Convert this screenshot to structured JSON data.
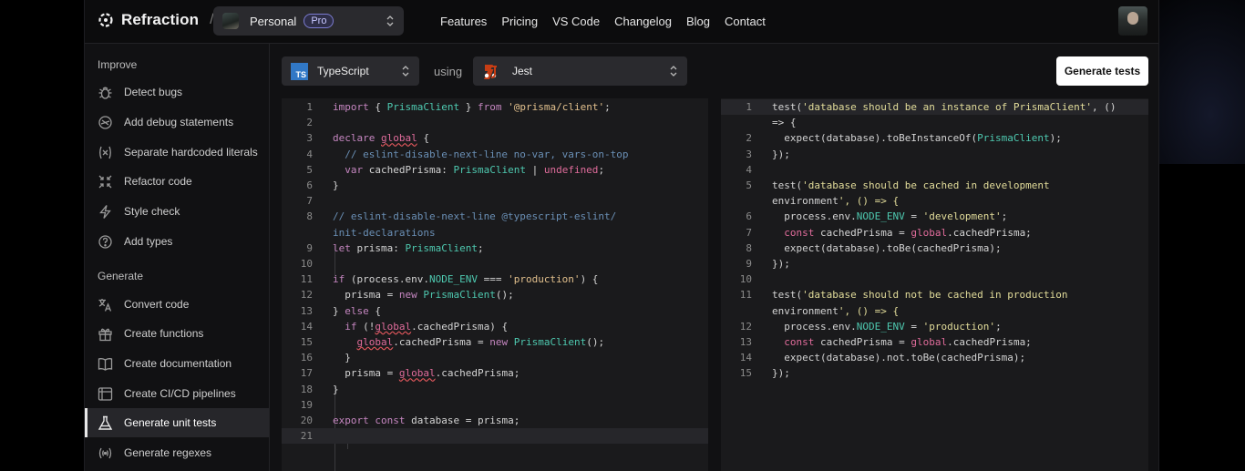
{
  "brand": {
    "name": "Refraction",
    "slash": "/"
  },
  "workspace": {
    "name": "Personal",
    "badge": "Pro"
  },
  "nav": [
    "Features",
    "Pricing",
    "VS Code",
    "Changelog",
    "Blog",
    "Contact"
  ],
  "sidebar": {
    "improve_title": "Improve",
    "improve": [
      {
        "label": "Detect bugs",
        "icon": "bug-icon"
      },
      {
        "label": "Add debug statements",
        "icon": "debug-icon"
      },
      {
        "label": "Separate hardcoded literals",
        "icon": "variable-icon"
      },
      {
        "label": "Refactor code",
        "icon": "refactor-icon"
      },
      {
        "label": "Style check",
        "icon": "lightning-icon"
      },
      {
        "label": "Add types",
        "icon": "question-circle-icon"
      }
    ],
    "generate_title": "Generate",
    "generate": [
      {
        "label": "Convert code",
        "icon": "translate-icon"
      },
      {
        "label": "Create functions",
        "icon": "gift-icon"
      },
      {
        "label": "Create documentation",
        "icon": "book-icon"
      },
      {
        "label": "Create CI/CD pipelines",
        "icon": "pipeline-icon"
      },
      {
        "label": "Generate unit tests",
        "icon": "flask-icon",
        "active": true
      },
      {
        "label": "Generate regexes",
        "icon": "regex-icon"
      }
    ]
  },
  "toolbar": {
    "language": "TypeScript",
    "language_badge": "TS",
    "using": "using",
    "framework": "Jest",
    "generate_label": "Generate tests"
  },
  "colors": {
    "accent_pro": "#7b7bd1",
    "ts_blue": "#3178c6",
    "jest_red": "#c63d14"
  },
  "source_code": [
    {
      "n": "1",
      "text": "import { PrismaClient } from '@prisma/client';"
    },
    {
      "n": "2",
      "text": ""
    },
    {
      "n": "3",
      "text": "declare global {"
    },
    {
      "n": "4",
      "text": "  // eslint-disable-next-line no-var, vars-on-top"
    },
    {
      "n": "5",
      "text": "  var cachedPrisma: PrismaClient | undefined;"
    },
    {
      "n": "6",
      "text": "}"
    },
    {
      "n": "7",
      "text": ""
    },
    {
      "n": "8",
      "text": "// eslint-disable-next-line @typescript-eslint/"
    },
    {
      "n": "",
      "text": "init-declarations"
    },
    {
      "n": "9",
      "text": "let prisma: PrismaClient;"
    },
    {
      "n": "10",
      "text": ""
    },
    {
      "n": "11",
      "text": "if (process.env.NODE_ENV === 'production') {"
    },
    {
      "n": "12",
      "text": "  prisma = new PrismaClient();"
    },
    {
      "n": "13",
      "text": "} else {"
    },
    {
      "n": "14",
      "text": "  if (!global.cachedPrisma) {"
    },
    {
      "n": "15",
      "text": "    global.cachedPrisma = new PrismaClient();"
    },
    {
      "n": "16",
      "text": "  }"
    },
    {
      "n": "17",
      "text": "  prisma = global.cachedPrisma;"
    },
    {
      "n": "18",
      "text": "}"
    },
    {
      "n": "19",
      "text": ""
    },
    {
      "n": "20",
      "text": "export const database = prisma;"
    },
    {
      "n": "21",
      "text": ""
    }
  ],
  "test_code": [
    {
      "n": "1",
      "text": "test('database should be an instance of PrismaClient', ()"
    },
    {
      "n": "",
      "text": "=> {"
    },
    {
      "n": "2",
      "text": "  expect(database).toBeInstanceOf(PrismaClient);"
    },
    {
      "n": "3",
      "text": "});"
    },
    {
      "n": "4",
      "text": ""
    },
    {
      "n": "5",
      "text": "test('database should be cached in development"
    },
    {
      "n": "",
      "text": "environment', () => {"
    },
    {
      "n": "6",
      "text": "  process.env.NODE_ENV = 'development';"
    },
    {
      "n": "7",
      "text": "  const cachedPrisma = global.cachedPrisma;"
    },
    {
      "n": "8",
      "text": "  expect(database).toBe(cachedPrisma);"
    },
    {
      "n": "9",
      "text": "});"
    },
    {
      "n": "10",
      "text": ""
    },
    {
      "n": "11",
      "text": "test('database should not be cached in production"
    },
    {
      "n": "",
      "text": "environment', () => {"
    },
    {
      "n": "12",
      "text": "  process.env.NODE_ENV = 'production';"
    },
    {
      "n": "13",
      "text": "  const cachedPrisma = global.cachedPrisma;"
    },
    {
      "n": "14",
      "text": "  expect(database).not.toBe(cachedPrisma);"
    },
    {
      "n": "15",
      "text": "});"
    }
  ]
}
